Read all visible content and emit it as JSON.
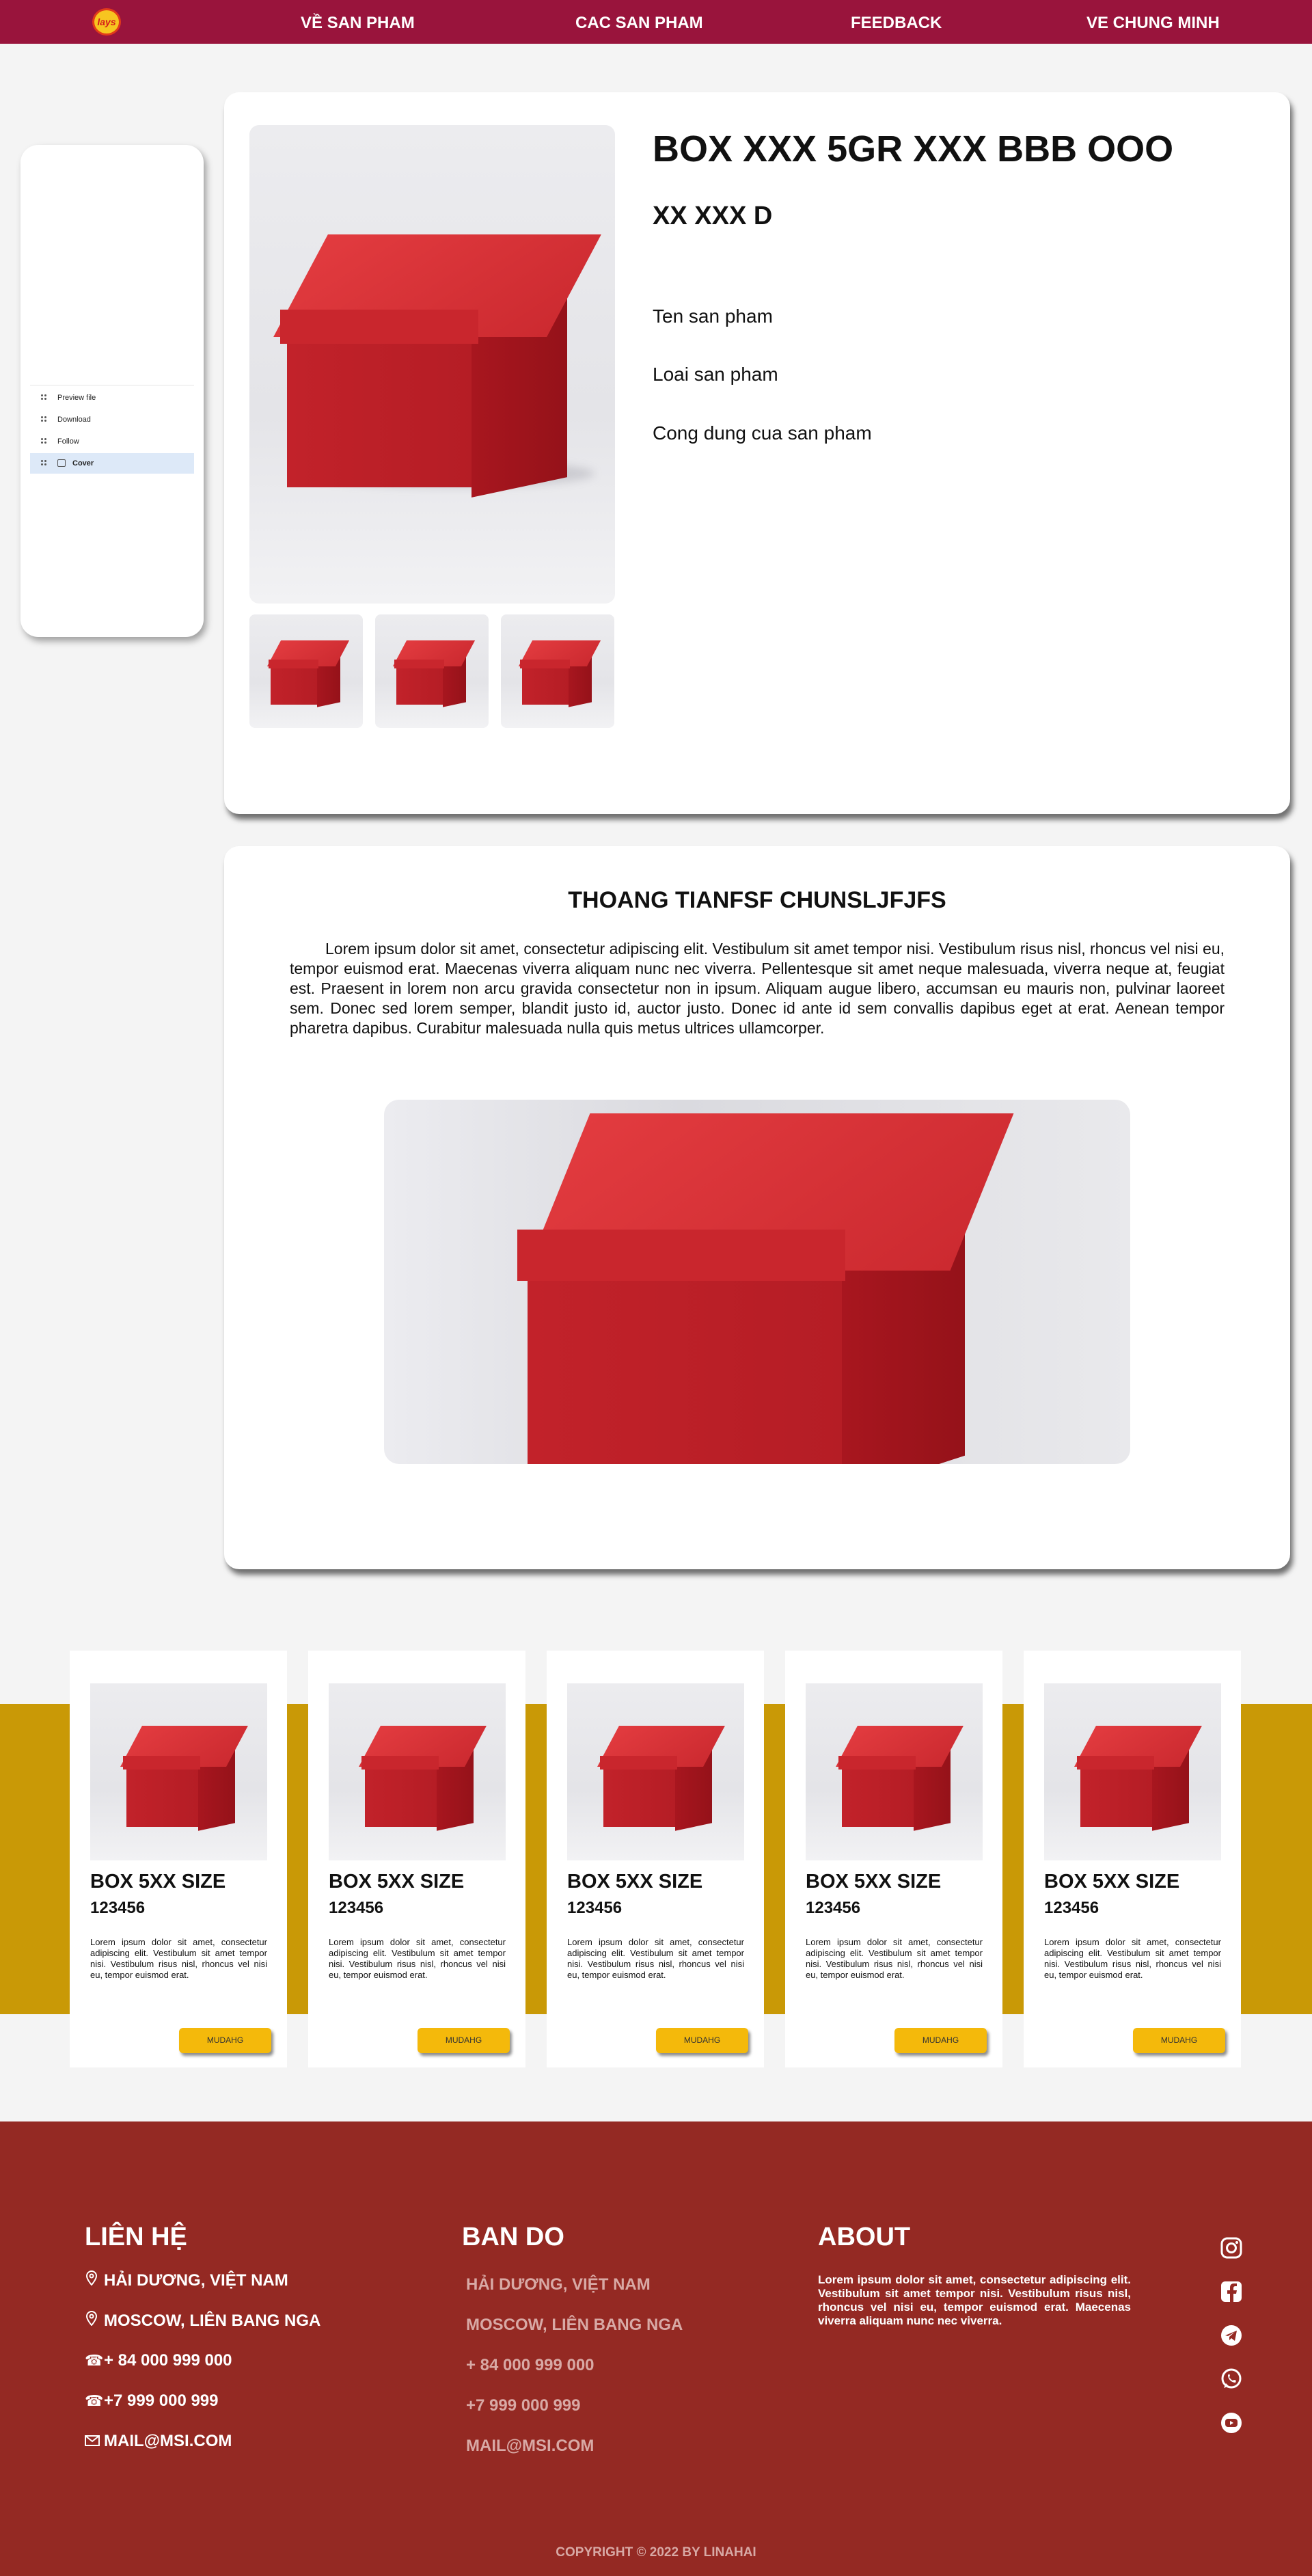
{
  "nav": {
    "logo_text": "lays",
    "items": [
      "VỀ SAN PHAM",
      "CAC SAN PHAM",
      "FEEDBACK",
      "VE CHUNG MINH"
    ]
  },
  "side_menu": {
    "items": [
      "Preview file",
      "Download",
      "Follow",
      "Cover"
    ],
    "active": "Cover"
  },
  "product": {
    "title": "BOX XXX 5GR XXX BBB OOO",
    "subtitle": "XX XXX D",
    "lines": [
      "Ten san pham",
      "Loai san pham",
      "Cong dung cua san pham"
    ]
  },
  "description": {
    "title": "THOANG TIANFSF CHUNSLJFJFS",
    "text": "Lorem ipsum dolor sit amet, consectetur adipiscing elit. Vestibulum sit amet tempor nisi. Vestibulum risus nisl, rhoncus vel nisi eu, tempor euismod erat. Maecenas viverra aliquam nunc nec viverra. Pellentesque sit amet neque malesuada, viverra neque at, feugiat est. Praesent in lorem non arcu gravida consectetur non in ipsum. Aliquam augue libero, accumsan eu mauris non, pulvinar laoreet sem. Donec sed lorem semper, blandit justo id, auctor justo. Donec id ante id sem convallis dapibus eget at erat. Aenean tempor pharetra dapibus. Curabitur malesuada nulla quis metus ultrices ullamcorper."
  },
  "products": [
    {
      "name": "BOX 5XX SIZE",
      "code": "123456",
      "desc": "Lorem ipsum dolor sit amet, consectetur adipiscing elit. Vestibulum sit amet tempor nisi. Vestibulum risus nisl, rhoncus vel nisi eu, tempor euismod erat.",
      "button": "MUDAHG"
    },
    {
      "name": "BOX 5XX SIZE",
      "code": "123456",
      "desc": "Lorem ipsum dolor sit amet, consectetur adipiscing elit. Vestibulum sit amet tempor nisi. Vestibulum risus nisl, rhoncus vel nisi eu, tempor euismod erat.",
      "button": "MUDAHG"
    },
    {
      "name": "BOX 5XX SIZE",
      "code": "123456",
      "desc": "Lorem ipsum dolor sit amet, consectetur adipiscing elit. Vestibulum sit amet tempor nisi. Vestibulum risus nisl, rhoncus vel nisi eu, tempor euismod erat.",
      "button": "MUDAHG"
    },
    {
      "name": "BOX 5XX SIZE",
      "code": "123456",
      "desc": "Lorem ipsum dolor sit amet, consectetur adipiscing elit. Vestibulum sit amet tempor nisi. Vestibulum risus nisl, rhoncus vel nisi eu, tempor euismod erat.",
      "button": "MUDAHG"
    },
    {
      "name": "BOX 5XX SIZE",
      "code": "123456",
      "desc": "Lorem ipsum dolor sit amet, consectetur adipiscing elit. Vestibulum sit amet tempor nisi. Vestibulum risus nisl, rhoncus vel nisi eu, tempor euismod erat.",
      "button": "MUDAHG"
    }
  ],
  "footer": {
    "contact_title": "LIÊN HỆ",
    "contacts": [
      {
        "icon": "location-pin-icon",
        "text": "HẢI DƯƠNG, VIỆT NAM"
      },
      {
        "icon": "location-pin-icon",
        "text": "MOSCOW, LIÊN BANG NGA"
      },
      {
        "icon": "phone-icon",
        "text": "+ 84 000 999 000"
      },
      {
        "icon": "phone-icon",
        "text": "+7 999 000 999"
      },
      {
        "icon": "mail-icon",
        "text": "MAIL@MSI.COM"
      }
    ],
    "map_title": "BAN DO",
    "map_items": [
      "HẢI DƯƠNG, VIỆT NAM",
      "MOSCOW, LIÊN BANG NGA",
      "+ 84 000 999 000",
      "+7 999 000 999",
      "MAIL@MSI.COM"
    ],
    "about_title": "ABOUT",
    "about_text": "Lorem ipsum dolor sit amet, consectetur adipiscing elit. Vestibulum sit amet tempor nisi. Vestibulum risus nisl, rhoncus vel nisi eu, tempor euismod erat. Maecenas viverra aliquam nunc nec viverra.",
    "social": [
      "instagram-icon",
      "facebook-icon",
      "telegram-icon",
      "whatsapp-icon",
      "youtube-icon"
    ],
    "copyright": "COPYRIGHT © 2022 BY LINAHAI"
  },
  "colors": {
    "nav_bg": "#99143c",
    "strip_bg": "#c99906",
    "button_bg": "#f4b90b",
    "footer_bg": "#942923",
    "side_active": "#dde9f8"
  }
}
